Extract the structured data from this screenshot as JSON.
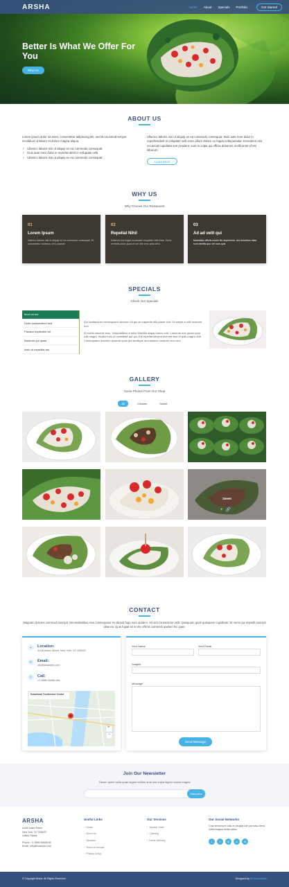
{
  "header": {
    "logo": "ARSHA",
    "nav": [
      "Home",
      "About",
      "Specials",
      "Portfolio"
    ],
    "cta": "Get Started"
  },
  "hero": {
    "title": "Better Is What We Offer For You",
    "button": "Why Us"
  },
  "about": {
    "title": "ABOUT US",
    "intro": "Lorem ipsum dolor sit amet, consectetur adipiscing elit, sed do eiusmod tempor incididunt ut labore et dolore magna aliqua.",
    "items": [
      "Ullamco laboris nisi ut aliquip ex ea commodo consequat",
      "Duis aute irure dolor in reprehenderit in voluptate velit",
      "Ullamco laboris nisi ut aliquip ex ea commodo consequat"
    ],
    "right_text": "Ullamco laboris nisi ut aliquip ex ea commodo consequat. Duis aute irure dolor in reprehenderit in voluptate velit esse cillum dolore eu fugiat nulla pariatur. Excepteur sint occaecat cupidatat non proident, sunt in culpa qui officia deserunt mollit anim id est laborum.",
    "button": "Learn More"
  },
  "why": {
    "title": "WHY US",
    "subtitle": "Why Choose Our Restaurant",
    "cards": [
      {
        "num": "01",
        "title": "Lorem Ipsum",
        "text": "Ulamco laboris nisi ut aliquip ex ea commodo consequat. Et consectetur ducimus vero placeat"
      },
      {
        "num": "02",
        "title": "Repellat Nihil",
        "text": "Dolorem est fugiat occaecati voluptate velit esse. Dicta veritatis dolor quod et vel dire leno para dest"
      },
      {
        "num": "03",
        "title": "Ad ad velit qui",
        "text": "Molestiae officiis omnis illo asperiores. Aut doloribus vitae sunt debitis quo vel nam quis"
      }
    ]
  },
  "specials": {
    "title": "SPECIALS",
    "subtitle": "Check Our Specials",
    "tabs": [
      "Modi sit est",
      "Unde praesentium sed",
      "Pariatur explicabo vel",
      "Nostrum qui quasi",
      "Iusto ut expedita aut"
    ],
    "p1": "Qui laudantium consequatur laborum sit qui ad sapiente dila parde sint. Ut saepe a nihil nostrum non.",
    "p2": "Et nobis maiores eius. Voluptatibus ut enim blandiis atque harum sint. Laborum eos ipsum ipsa odit magni. Incidunt hic ut molestiae aut qui. Est repellat minima eveniet eius et quis magni nihil. Consequatur dolorem quaerat quos qui similique accusamus nostrum rem vero"
  },
  "gallery": {
    "title": "GALLERY",
    "subtitle": "Some Photos From Our Shop",
    "filters": [
      "All",
      "Chicken",
      "Sweet"
    ],
    "overlay_title": "Sweet"
  },
  "contact": {
    "title": "CONTACT",
    "description": "Magnam dolores commodi suscipit. Necessitatibus eius consequatur ex aliquid fuga eum quidem. Sit sint consectetur velit. Quisquam quos quisquam cupiditate. Et nemo qui impedit suscipit alias ea. Quia fugiat sit in iste officiis commodi quidem hic quas.",
    "location_label": "Location:",
    "location_value": "A108 Adam Street, New York, NY 535022",
    "email_label": "Email:",
    "email_value": "info@example.com",
    "call_label": "Call:",
    "call_value": "+1 5589 55488 55s",
    "map_label": "Downtown Conference Center",
    "form": {
      "name_label": "Your Name",
      "email_label": "Your Email",
      "subject_label": "Subject",
      "message_label": "Message",
      "button": "Send Message"
    }
  },
  "newsletter": {
    "title": "Join Our Newsletter",
    "subtitle": "Tamen quem nulla quae legam multos aute sint culpa legam noster magna",
    "button": "Subscribe"
  },
  "footer": {
    "logo": "ARSHA",
    "address": [
      "A108 Adam Street",
      "New York, NY 535022",
      "United States"
    ],
    "phone": "Phone: +1 5589 55488 55",
    "email": "Email: info@example.com",
    "useful_title": "Useful Links",
    "useful": [
      "Home",
      "About us",
      "Services",
      "Terms of service",
      "Privacy policy"
    ],
    "services_title": "Our Services",
    "services": [
      "Special Order",
      "Catering",
      "Home Delivery"
    ],
    "social_title": "Our Social Networks",
    "social_text": "Cras fermentum odio eu feugiat lide par naso tierra videa magna derita valies",
    "social_icons": [
      "twitter-icon",
      "facebook-icon",
      "instagram-icon",
      "skype-icon",
      "linkedin-icon"
    ],
    "copyright": "© Copyright Arsha. All Rights Reserved",
    "designed_prefix": "Designed by",
    "designed_by": "BootstrapMade"
  },
  "colors": {
    "brand": "#37517e",
    "accent": "#47b2e4",
    "card_dark": "#3d3832",
    "special_tab": "#1b7a55"
  }
}
